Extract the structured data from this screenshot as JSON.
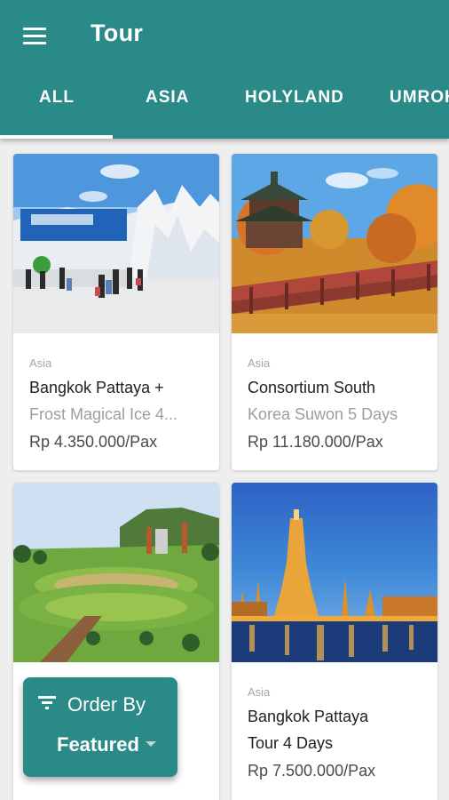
{
  "appbar": {
    "title": "Tour",
    "menu_icon": "hamburger-menu-icon",
    "color": "#2a8a88"
  },
  "tabs": [
    {
      "label": "ALL",
      "selected": true
    },
    {
      "label": "ASIA",
      "selected": false
    },
    {
      "label": "HOLYLAND",
      "selected": false
    },
    {
      "label": "UMROH",
      "selected": false
    }
  ],
  "tours": [
    {
      "category": "Asia",
      "name_line1": "Bangkok Pattaya +",
      "name_line2": "Frost Magical Ice 4...",
      "price": "Rp 4.350.000/Pax",
      "image": "ice-sculpture-photo"
    },
    {
      "category": "Asia",
      "name_line1": "Consortium South",
      "name_line2": "Korea Suwon 5 Days",
      "price": "Rp 11.180.000/Pax",
      "image": "korean-pavilion-photo"
    },
    {
      "category": "",
      "name_line1": "",
      "name_line2": "",
      "price": "",
      "image": "nong-nooch-garden-photo"
    },
    {
      "category": "Asia",
      "name_line1": "Bangkok Pattaya",
      "name_line2": "Tour 4 Days",
      "price": "Rp 7.500.000/Pax",
      "image": "wat-arun-photo"
    }
  ],
  "order_by": {
    "label": "Order By",
    "value": "Featured",
    "icon": "filter-list-icon"
  }
}
